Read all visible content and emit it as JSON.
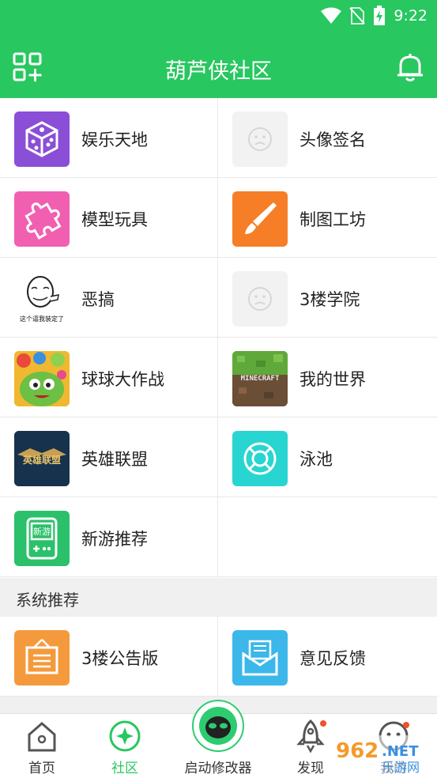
{
  "status": {
    "time": "9:22"
  },
  "header": {
    "title": "葫芦侠社区"
  },
  "grid": [
    {
      "label": "娱乐天地",
      "icon": "dice-icon",
      "color": "#8a4fd6"
    },
    {
      "label": "头像签名",
      "icon": "placeholder-face-icon",
      "color": "#f2f2f2"
    },
    {
      "label": "模型玩具",
      "icon": "puzzle-icon",
      "color": "#f15fb0"
    },
    {
      "label": "制图工坊",
      "icon": "brush-icon",
      "color": "#f57e26"
    },
    {
      "label": "恶搞",
      "icon": "meme-face-icon",
      "color": "#ffffff"
    },
    {
      "label": "3楼学院",
      "icon": "placeholder-face-icon",
      "color": "#f2f2f2"
    },
    {
      "label": "球球大作战",
      "icon": "ball-game-icon",
      "color": "#7ac143"
    },
    {
      "label": "我的世界",
      "icon": "minecraft-icon",
      "color": "#5a4a3a"
    },
    {
      "label": "英雄联盟",
      "icon": "lol-icon",
      "color": "#1c3a55"
    },
    {
      "label": "泳池",
      "icon": "lifebuoy-icon",
      "color": "#28d5d0"
    },
    {
      "label": "新游推荐",
      "icon": "gamepad-device-icon",
      "color": "#2bc06a"
    }
  ],
  "meme_caption": "这个逼我装定了",
  "new_game_icon_text": "新游",
  "minecraft_logo_text": "MINECRAFT",
  "lol_logo_text": "英雄联盟",
  "section": {
    "title": "系统推荐"
  },
  "system": [
    {
      "label": "3楼公告版",
      "icon": "notice-board-icon",
      "color": "#f59a3c"
    },
    {
      "label": "意见反馈",
      "icon": "mail-feedback-icon",
      "color": "#3bb7ea"
    }
  ],
  "tabs": [
    {
      "label": "首页"
    },
    {
      "label": "社区"
    },
    {
      "label": "启动修改器"
    },
    {
      "label": "发现"
    },
    {
      "label": "我的"
    }
  ],
  "watermark": "962.NET 乐游网",
  "colors": {
    "primary": "#28c760",
    "badge": "#f0502c"
  }
}
